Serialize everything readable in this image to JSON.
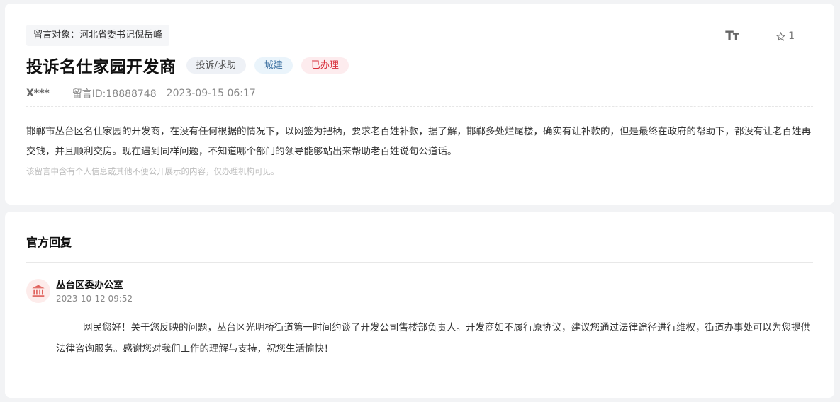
{
  "message": {
    "target": "留言对象：河北省委书记倪岳峰",
    "title": "投诉名仕家园开发商",
    "tags": {
      "type": "投诉/求助",
      "category": "城建",
      "status": "已办理"
    },
    "author": "X***",
    "message_id": "留言ID:18888748",
    "date": "2023-09-15 06:17",
    "content": "邯郸市丛台区名仕家园的开发商，在没有任何根据的情况下，以网签为把柄，要求老百姓补款，据了解，邯郸多处烂尾楼，确实有让补款的，但是最终在政府的帮助下，都没有让老百姓再交钱，并且顺利交房。现在遇到同样问题，不知道哪个部门的领导能够站出来帮助老百姓说句公道话。",
    "privacy_note": "该留言中含有个人信息或其他不便公开展示的内容，仅办理机构可见。"
  },
  "toolbar": {
    "font_size_icon": "font-size-icon",
    "favorite_icon": "star-icon",
    "favorite_count": "1"
  },
  "reply": {
    "heading": "官方回复",
    "org_icon": "government-building-icon",
    "org_name": "丛台区委办公室",
    "date": "2023-10-12 09:52",
    "content": "网民您好！关于您反映的问题，丛台区光明桥街道第一时间约谈了开发公司售楼部负责人。开发商如不履行原协议，建议您通过法律途径进行维权，街道办事处可以为您提供法律咨询服务。感谢您对我们工作的理解与支持，祝您生活愉快！"
  },
  "colors": {
    "status_red": "#d8303c",
    "category_blue": "#3b6fa0",
    "page_bg": "#f2f3f5"
  }
}
